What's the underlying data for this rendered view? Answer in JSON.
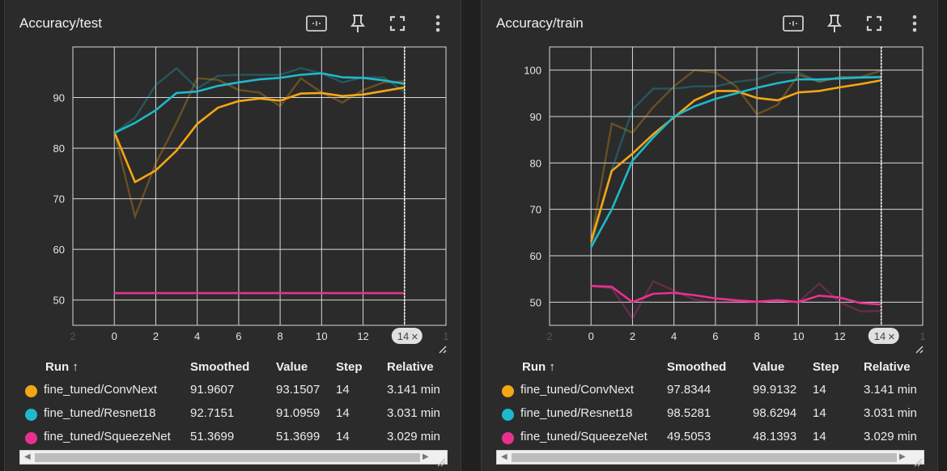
{
  "colors": {
    "convnext": "#f5a614",
    "resnet": "#1fb8cc",
    "squeezenet": "#e8318f",
    "bg": "#2b2b2b",
    "grid": "#cfcfcf"
  },
  "icons": [
    "fit-domain-icon",
    "pin-icon",
    "fullscreen-icon",
    "more-vert-icon"
  ],
  "table_headers": {
    "run": "Run ↑",
    "smoothed": "Smoothed",
    "value": "Value",
    "step": "Step",
    "relative": "Relative"
  },
  "step_badge": "14",
  "step_badge_close": "✕",
  "panels": [
    {
      "title": "Accuracy/test",
      "rows": [
        {
          "run": "fine_tuned/ConvNext",
          "smoothed": "91.9607",
          "value": "93.1507",
          "step": "14",
          "relative": "3.141 min"
        },
        {
          "run": "fine_tuned/Resnet18",
          "smoothed": "92.7151",
          "value": "91.0959",
          "step": "14",
          "relative": "3.031 min"
        },
        {
          "run": "fine_tuned/SqueezeNet",
          "smoothed": "51.3699",
          "value": "51.3699",
          "step": "14",
          "relative": "3.029 min"
        }
      ]
    },
    {
      "title": "Accuracy/train",
      "rows": [
        {
          "run": "fine_tuned/ConvNext",
          "smoothed": "97.8344",
          "value": "99.9132",
          "step": "14",
          "relative": "3.141 min"
        },
        {
          "run": "fine_tuned/Resnet18",
          "smoothed": "98.5281",
          "value": "98.6294",
          "step": "14",
          "relative": "3.031 min"
        },
        {
          "run": "fine_tuned/SqueezeNet",
          "smoothed": "49.5053",
          "value": "48.1393",
          "step": "14",
          "relative": "3.029 min"
        }
      ]
    }
  ],
  "chart_data": [
    {
      "type": "line",
      "title": "Accuracy/test",
      "x_ticks": [
        "2",
        "0",
        "2",
        "4",
        "6",
        "8",
        "10",
        "12",
        "14",
        "1"
      ],
      "y_ticks": [
        50,
        60,
        70,
        80,
        90
      ],
      "xlim": [
        -2,
        16
      ],
      "ylim": [
        45,
        100
      ],
      "grid": true,
      "x": [
        0,
        1,
        2,
        3,
        4,
        5,
        6,
        7,
        8,
        9,
        10,
        11,
        12,
        13,
        14
      ],
      "series": [
        {
          "name": "fine_tuned/ConvNext",
          "color": "#f5a614",
          "smoothed": [
            83.2,
            73.3,
            75.6,
            79.5,
            84.8,
            88.0,
            89.3,
            89.8,
            89.4,
            90.8,
            90.9,
            90.3,
            90.6,
            91.3,
            92.0
          ],
          "raw": [
            83.2,
            66.5,
            77.0,
            85.0,
            93.8,
            93.5,
            91.5,
            91.0,
            88.3,
            93.8,
            91.0,
            89.0,
            91.5,
            93.0,
            93.2
          ]
        },
        {
          "name": "fine_tuned/Resnet18",
          "color": "#1fb8cc",
          "smoothed": [
            83.0,
            85.0,
            87.5,
            90.9,
            91.2,
            92.3,
            93.0,
            93.6,
            93.9,
            94.5,
            94.8,
            94.0,
            93.9,
            93.4,
            92.7
          ],
          "raw": [
            83.0,
            86.0,
            92.5,
            95.8,
            91.8,
            94.3,
            94.5,
            94.5,
            94.5,
            95.8,
            94.8,
            93.0,
            94.0,
            94.0,
            91.1
          ]
        },
        {
          "name": "fine_tuned/SqueezeNet",
          "color": "#e8318f",
          "smoothed": [
            51.37,
            51.37,
            51.37,
            51.37,
            51.37,
            51.37,
            51.37,
            51.37,
            51.37,
            51.37,
            51.37,
            51.37,
            51.37,
            51.37,
            51.37
          ],
          "raw": [
            51.37,
            51.37,
            51.37,
            51.37,
            51.37,
            51.37,
            51.37,
            51.37,
            51.37,
            51.37,
            51.37,
            51.37,
            51.37,
            51.37,
            51.37
          ]
        }
      ]
    },
    {
      "type": "line",
      "title": "Accuracy/train",
      "x_ticks": [
        "2",
        "0",
        "2",
        "4",
        "6",
        "8",
        "10",
        "12",
        "14",
        "1"
      ],
      "y_ticks": [
        50,
        60,
        70,
        80,
        90,
        100
      ],
      "xlim": [
        -2,
        16
      ],
      "ylim": [
        45,
        105
      ],
      "grid": true,
      "x": [
        0,
        1,
        2,
        3,
        4,
        5,
        6,
        7,
        8,
        9,
        10,
        11,
        12,
        13,
        14
      ],
      "series": [
        {
          "name": "fine_tuned/ConvNext",
          "color": "#f5a614",
          "smoothed": [
            63.0,
            78.3,
            82.0,
            86.2,
            89.8,
            93.5,
            95.5,
            95.5,
            94.0,
            93.5,
            95.2,
            95.5,
            96.3,
            97.0,
            97.8
          ],
          "raw": [
            63.0,
            88.5,
            86.5,
            92.0,
            96.5,
            100.0,
            99.5,
            96.5,
            90.5,
            92.5,
            99.0,
            97.5,
            98.5,
            98.5,
            99.9
          ]
        },
        {
          "name": "fine_tuned/Resnet18",
          "color": "#1fb8cc",
          "smoothed": [
            61.8,
            70.0,
            80.5,
            85.5,
            90.0,
            92.2,
            93.8,
            95.0,
            96.2,
            97.2,
            98.0,
            98.0,
            98.2,
            98.4,
            98.5
          ],
          "raw": [
            61.8,
            78.5,
            91.5,
            96.0,
            96.0,
            96.5,
            96.5,
            97.5,
            98.0,
            99.5,
            99.5,
            97.5,
            98.5,
            98.5,
            98.6
          ]
        },
        {
          "name": "fine_tuned/SqueezeNet",
          "color": "#e8318f",
          "smoothed": [
            53.5,
            53.3,
            50.0,
            51.8,
            52.0,
            51.5,
            50.8,
            50.4,
            50.1,
            50.4,
            50.0,
            51.4,
            51.0,
            49.8,
            49.5
          ],
          "raw": [
            53.5,
            53.0,
            46.5,
            54.5,
            52.5,
            50.5,
            50.0,
            50.0,
            50.0,
            50.5,
            50.0,
            54.0,
            50.0,
            48.0,
            48.1
          ]
        }
      ]
    }
  ]
}
